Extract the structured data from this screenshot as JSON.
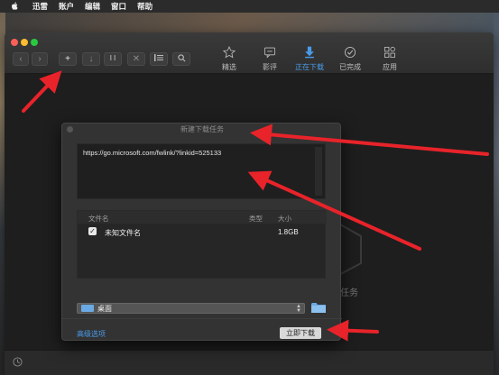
{
  "menubar": {
    "apple": "",
    "items": [
      "迅雷",
      "账户",
      "编辑",
      "窗口",
      "帮助"
    ]
  },
  "toolbar": {
    "back": "‹",
    "forward": "›",
    "add": "+",
    "download": "↓",
    "pause": "⏸",
    "delete": "✕",
    "list": "☰",
    "search": "⌕"
  },
  "nav_tabs": [
    {
      "label": "精选",
      "icon": "star-icon"
    },
    {
      "label": "影评",
      "icon": "comment-icon"
    },
    {
      "label": "正在下载",
      "icon": "download-icon",
      "active": true
    },
    {
      "label": "已完成",
      "icon": "check-circle-icon"
    },
    {
      "label": "应用",
      "icon": "apps-icon"
    }
  ],
  "background_partial_text": "任务",
  "dialog": {
    "title": "新建下载任务",
    "url": "https://go.microsoft.com/fwlink/?linkid=525133",
    "table": {
      "headers": {
        "name": "文件名",
        "type": "类型",
        "size": "大小"
      },
      "rows": [
        {
          "checked": true,
          "name": "未知文件名",
          "type": "",
          "size": "1.8GB"
        }
      ]
    },
    "save_location": "桌面",
    "advanced_label": "高级选项",
    "download_now_label": "立即下载"
  },
  "colors": {
    "accent": "#4a9be9",
    "arrow": "#e8232a",
    "window_bg": "#232323",
    "dialog_bg": "#333333"
  }
}
